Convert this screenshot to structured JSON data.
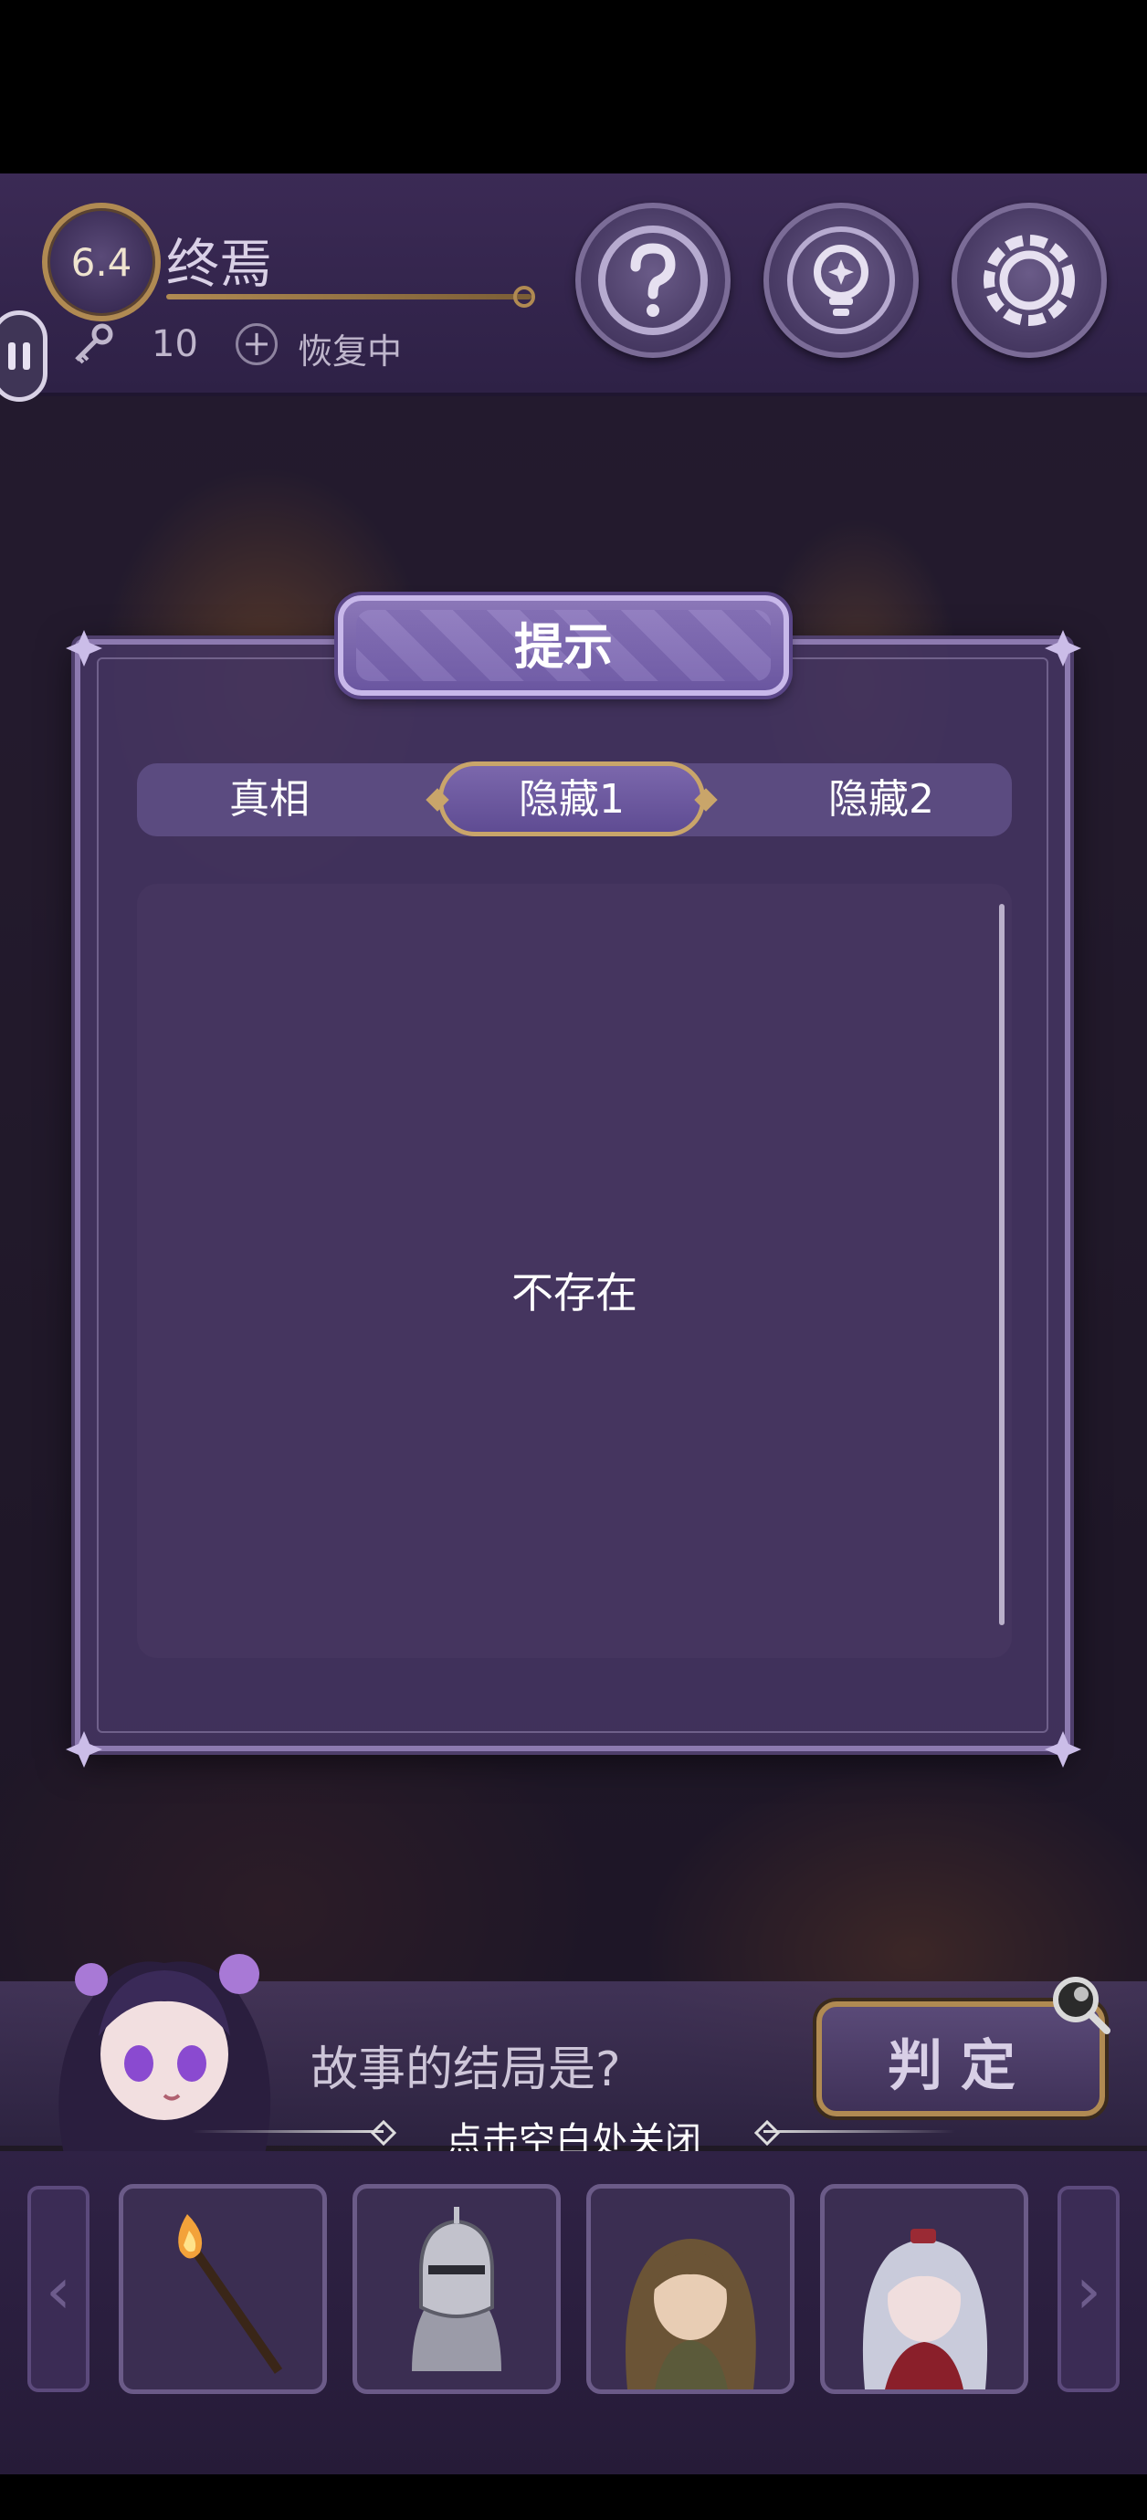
{
  "hud": {
    "level": "6.4",
    "chapter_title": "终焉",
    "keys": "10",
    "recover_status": "恢复中"
  },
  "modal": {
    "title": "提示",
    "tabs": [
      "真相",
      "隐藏1",
      "隐藏2"
    ],
    "selected_tab": "隐藏1",
    "content": "不存在"
  },
  "bottom": {
    "question": "故事的结局是?",
    "judge_label": "判定",
    "close_hint": "点击空白处关闭",
    "items": [
      "torch-item",
      "knight-item",
      "long-hair-character-item",
      "silver-hair-character-item"
    ]
  },
  "icons": {
    "help": "question-icon",
    "hint": "lightbulb-icon",
    "settings": "gear-icon",
    "key": "key-icon",
    "plus": "plus-icon"
  },
  "colors": {
    "panel": "#443460",
    "accent_gold": "#b08a52",
    "tab_bar": "#5b4b80"
  }
}
